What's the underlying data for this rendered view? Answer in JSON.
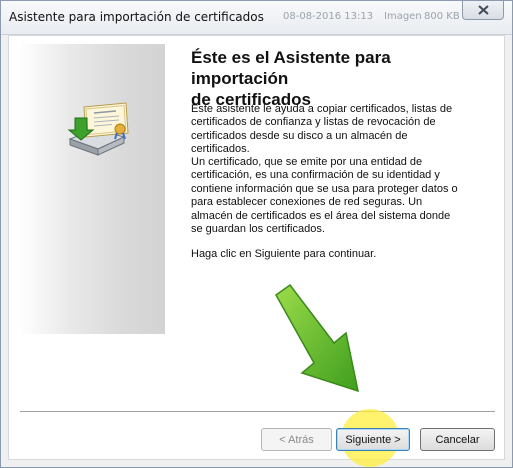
{
  "window": {
    "title": "Asistente para importación de certificados",
    "ghost_texts": [
      "08-08-2016 13:13",
      "Imagen",
      "800 KB"
    ]
  },
  "main": {
    "heading_line1": "Éste es el Asistente para importación",
    "heading_line2": "de certificados",
    "paragraph1": "Este asistente le ayuda a copiar certificados, listas de certificados de confianza y listas de revocación de certificados desde su disco a un almacén de certificados.",
    "paragraph2": "Un certificado, que se emite por una entidad de certificación, es una confirmación de su identidad y contiene información que se usa para proteger datos o para establecer conexiones de red seguras. Un almacén de certificados es el área del sistema donde se guardan los certificados.",
    "paragraph3": "Haga clic en Siguiente para continuar."
  },
  "buttons": {
    "back": "< Atrás",
    "next": "Siguiente >",
    "cancel": "Cancelar"
  },
  "icons": [
    "certificate-import-icon",
    "close-icon",
    "pointer-arrow-icon"
  ],
  "colors": {
    "arrow_green": "#5cb82a",
    "highlight_yellow": "#ffee3c",
    "default_button_border": "#3c7fb1"
  }
}
